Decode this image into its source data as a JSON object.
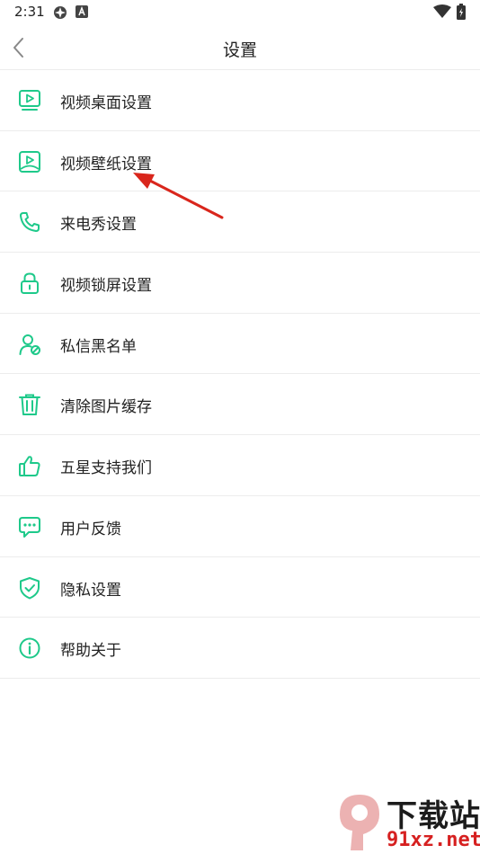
{
  "status_bar": {
    "time": "2:31",
    "icons": [
      "app-icon",
      "a-icon",
      "wifi-icon",
      "battery-icon"
    ]
  },
  "header": {
    "title": "设置",
    "back_icon": "chevron-left-icon"
  },
  "menu": {
    "items": [
      {
        "label": "视频桌面设置",
        "icon": "video-desktop-icon"
      },
      {
        "label": "视频壁纸设置",
        "icon": "video-wallpaper-icon"
      },
      {
        "label": "来电秀设置",
        "icon": "phone-icon"
      },
      {
        "label": "视频锁屏设置",
        "icon": "lock-icon"
      },
      {
        "label": "私信黑名单",
        "icon": "user-blocked-icon"
      },
      {
        "label": "清除图片缓存",
        "icon": "trash-icon"
      },
      {
        "label": "五星支持我们",
        "icon": "thumbs-up-icon"
      },
      {
        "label": "用户反馈",
        "icon": "feedback-icon"
      },
      {
        "label": "隐私设置",
        "icon": "shield-check-icon"
      },
      {
        "label": "帮助关于",
        "icon": "info-icon"
      }
    ]
  },
  "annotation": {
    "icon": "red-arrow-icon"
  },
  "watermark": {
    "title": "下载站",
    "url": "91xz.net"
  },
  "colors": {
    "accent": "#1ec98a",
    "arrow": "#d9261c",
    "divider": "#ececec"
  }
}
